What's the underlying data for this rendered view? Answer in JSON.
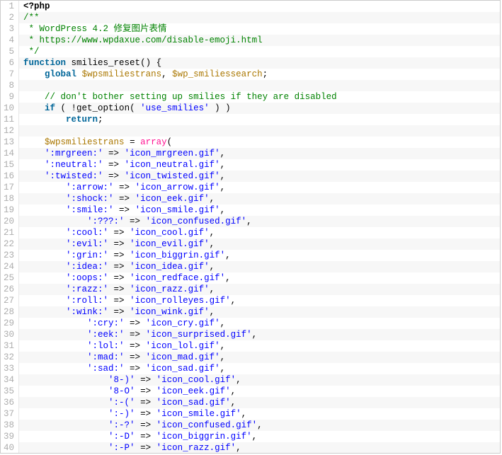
{
  "code": {
    "lines": [
      {
        "n": 1,
        "indent": 0,
        "tokens": [
          {
            "t": "<?php",
            "c": "tok-open"
          }
        ]
      },
      {
        "n": 2,
        "indent": 0,
        "tokens": [
          {
            "t": "/**",
            "c": "tok-comment"
          }
        ]
      },
      {
        "n": 3,
        "indent": 0,
        "tokens": [
          {
            "t": " * WordPress 4.2 修复图片表情",
            "c": "tok-comment"
          }
        ]
      },
      {
        "n": 4,
        "indent": 0,
        "tokens": [
          {
            "t": " * https://www.wpdaxue.com/disable-emoji.html",
            "c": "tok-comment"
          }
        ]
      },
      {
        "n": 5,
        "indent": 0,
        "tokens": [
          {
            "t": " */",
            "c": "tok-comment"
          }
        ]
      },
      {
        "n": 6,
        "indent": 0,
        "tokens": [
          {
            "t": "function",
            "c": "tok-keyword"
          },
          {
            "t": " ",
            "c": ""
          },
          {
            "t": "smilies_reset",
            "c": "tok-funcname"
          },
          {
            "t": "() {",
            "c": "tok-brace"
          }
        ]
      },
      {
        "n": 7,
        "indent": 1,
        "tokens": [
          {
            "t": "global",
            "c": "tok-keyword"
          },
          {
            "t": " ",
            "c": ""
          },
          {
            "t": "$wpsmiliestrans",
            "c": "tok-var"
          },
          {
            "t": ", ",
            "c": "tok-punct"
          },
          {
            "t": "$wp_smiliessearch",
            "c": "tok-var"
          },
          {
            "t": ";",
            "c": "tok-punct"
          }
        ]
      },
      {
        "n": 8,
        "indent": 0,
        "tokens": []
      },
      {
        "n": 9,
        "indent": 1,
        "tokens": [
          {
            "t": "// don't bother setting up smilies if they are disabled",
            "c": "tok-comment"
          }
        ]
      },
      {
        "n": 10,
        "indent": 1,
        "tokens": [
          {
            "t": "if",
            "c": "tok-keyword"
          },
          {
            "t": " ( !get_option( ",
            "c": "tok-punct"
          },
          {
            "t": "'use_smilies'",
            "c": "tok-string"
          },
          {
            "t": " ) )",
            "c": "tok-punct"
          }
        ]
      },
      {
        "n": 11,
        "indent": 2,
        "tokens": [
          {
            "t": "return",
            "c": "tok-keyword"
          },
          {
            "t": ";",
            "c": "tok-punct"
          }
        ]
      },
      {
        "n": 12,
        "indent": 0,
        "tokens": []
      },
      {
        "n": 13,
        "indent": 1,
        "tokens": [
          {
            "t": "$wpsmiliestrans",
            "c": "tok-var"
          },
          {
            "t": " = ",
            "c": "tok-eq"
          },
          {
            "t": "array",
            "c": "tok-func"
          },
          {
            "t": "(",
            "c": "tok-punct"
          }
        ]
      },
      {
        "n": 14,
        "indent": 1,
        "tokens": [
          {
            "t": "':mrgreen:'",
            "c": "tok-string"
          },
          {
            "t": " => ",
            "c": "tok-arrow"
          },
          {
            "t": "'icon_mrgreen.gif'",
            "c": "tok-string"
          },
          {
            "t": ",",
            "c": "tok-punct"
          }
        ]
      },
      {
        "n": 15,
        "indent": 1,
        "tokens": [
          {
            "t": "':neutral:'",
            "c": "tok-string"
          },
          {
            "t": " => ",
            "c": "tok-arrow"
          },
          {
            "t": "'icon_neutral.gif'",
            "c": "tok-string"
          },
          {
            "t": ",",
            "c": "tok-punct"
          }
        ]
      },
      {
        "n": 16,
        "indent": 1,
        "tokens": [
          {
            "t": "':twisted:'",
            "c": "tok-string"
          },
          {
            "t": " => ",
            "c": "tok-arrow"
          },
          {
            "t": "'icon_twisted.gif'",
            "c": "tok-string"
          },
          {
            "t": ",",
            "c": "tok-punct"
          }
        ]
      },
      {
        "n": 17,
        "indent": 2,
        "tokens": [
          {
            "t": "':arrow:'",
            "c": "tok-string"
          },
          {
            "t": " => ",
            "c": "tok-arrow"
          },
          {
            "t": "'icon_arrow.gif'",
            "c": "tok-string"
          },
          {
            "t": ",",
            "c": "tok-punct"
          }
        ]
      },
      {
        "n": 18,
        "indent": 2,
        "tokens": [
          {
            "t": "':shock:'",
            "c": "tok-string"
          },
          {
            "t": " => ",
            "c": "tok-arrow"
          },
          {
            "t": "'icon_eek.gif'",
            "c": "tok-string"
          },
          {
            "t": ",",
            "c": "tok-punct"
          }
        ]
      },
      {
        "n": 19,
        "indent": 2,
        "tokens": [
          {
            "t": "':smile:'",
            "c": "tok-string"
          },
          {
            "t": " => ",
            "c": "tok-arrow"
          },
          {
            "t": "'icon_smile.gif'",
            "c": "tok-string"
          },
          {
            "t": ",",
            "c": "tok-punct"
          }
        ]
      },
      {
        "n": 20,
        "indent": 3,
        "tokens": [
          {
            "t": "':???:'",
            "c": "tok-string"
          },
          {
            "t": " => ",
            "c": "tok-arrow"
          },
          {
            "t": "'icon_confused.gif'",
            "c": "tok-string"
          },
          {
            "t": ",",
            "c": "tok-punct"
          }
        ]
      },
      {
        "n": 21,
        "indent": 2,
        "tokens": [
          {
            "t": "':cool:'",
            "c": "tok-string"
          },
          {
            "t": " => ",
            "c": "tok-arrow"
          },
          {
            "t": "'icon_cool.gif'",
            "c": "tok-string"
          },
          {
            "t": ",",
            "c": "tok-punct"
          }
        ]
      },
      {
        "n": 22,
        "indent": 2,
        "tokens": [
          {
            "t": "':evil:'",
            "c": "tok-string"
          },
          {
            "t": " => ",
            "c": "tok-arrow"
          },
          {
            "t": "'icon_evil.gif'",
            "c": "tok-string"
          },
          {
            "t": ",",
            "c": "tok-punct"
          }
        ]
      },
      {
        "n": 23,
        "indent": 2,
        "tokens": [
          {
            "t": "':grin:'",
            "c": "tok-string"
          },
          {
            "t": " => ",
            "c": "tok-arrow"
          },
          {
            "t": "'icon_biggrin.gif'",
            "c": "tok-string"
          },
          {
            "t": ",",
            "c": "tok-punct"
          }
        ]
      },
      {
        "n": 24,
        "indent": 2,
        "tokens": [
          {
            "t": "':idea:'",
            "c": "tok-string"
          },
          {
            "t": " => ",
            "c": "tok-arrow"
          },
          {
            "t": "'icon_idea.gif'",
            "c": "tok-string"
          },
          {
            "t": ",",
            "c": "tok-punct"
          }
        ]
      },
      {
        "n": 25,
        "indent": 2,
        "tokens": [
          {
            "t": "':oops:'",
            "c": "tok-string"
          },
          {
            "t": " => ",
            "c": "tok-arrow"
          },
          {
            "t": "'icon_redface.gif'",
            "c": "tok-string"
          },
          {
            "t": ",",
            "c": "tok-punct"
          }
        ]
      },
      {
        "n": 26,
        "indent": 2,
        "tokens": [
          {
            "t": "':razz:'",
            "c": "tok-string"
          },
          {
            "t": " => ",
            "c": "tok-arrow"
          },
          {
            "t": "'icon_razz.gif'",
            "c": "tok-string"
          },
          {
            "t": ",",
            "c": "tok-punct"
          }
        ]
      },
      {
        "n": 27,
        "indent": 2,
        "tokens": [
          {
            "t": "':roll:'",
            "c": "tok-string"
          },
          {
            "t": " => ",
            "c": "tok-arrow"
          },
          {
            "t": "'icon_rolleyes.gif'",
            "c": "tok-string"
          },
          {
            "t": ",",
            "c": "tok-punct"
          }
        ]
      },
      {
        "n": 28,
        "indent": 2,
        "tokens": [
          {
            "t": "':wink:'",
            "c": "tok-string"
          },
          {
            "t": " => ",
            "c": "tok-arrow"
          },
          {
            "t": "'icon_wink.gif'",
            "c": "tok-string"
          },
          {
            "t": ",",
            "c": "tok-punct"
          }
        ]
      },
      {
        "n": 29,
        "indent": 3,
        "tokens": [
          {
            "t": "':cry:'",
            "c": "tok-string"
          },
          {
            "t": " => ",
            "c": "tok-arrow"
          },
          {
            "t": "'icon_cry.gif'",
            "c": "tok-string"
          },
          {
            "t": ",",
            "c": "tok-punct"
          }
        ]
      },
      {
        "n": 30,
        "indent": 3,
        "tokens": [
          {
            "t": "':eek:'",
            "c": "tok-string"
          },
          {
            "t": " => ",
            "c": "tok-arrow"
          },
          {
            "t": "'icon_surprised.gif'",
            "c": "tok-string"
          },
          {
            "t": ",",
            "c": "tok-punct"
          }
        ]
      },
      {
        "n": 31,
        "indent": 3,
        "tokens": [
          {
            "t": "':lol:'",
            "c": "tok-string"
          },
          {
            "t": " => ",
            "c": "tok-arrow"
          },
          {
            "t": "'icon_lol.gif'",
            "c": "tok-string"
          },
          {
            "t": ",",
            "c": "tok-punct"
          }
        ]
      },
      {
        "n": 32,
        "indent": 3,
        "tokens": [
          {
            "t": "':mad:'",
            "c": "tok-string"
          },
          {
            "t": " => ",
            "c": "tok-arrow"
          },
          {
            "t": "'icon_mad.gif'",
            "c": "tok-string"
          },
          {
            "t": ",",
            "c": "tok-punct"
          }
        ]
      },
      {
        "n": 33,
        "indent": 3,
        "tokens": [
          {
            "t": "':sad:'",
            "c": "tok-string"
          },
          {
            "t": " => ",
            "c": "tok-arrow"
          },
          {
            "t": "'icon_sad.gif'",
            "c": "tok-string"
          },
          {
            "t": ",",
            "c": "tok-punct"
          }
        ]
      },
      {
        "n": 34,
        "indent": 4,
        "tokens": [
          {
            "t": "'8-)'",
            "c": "tok-string"
          },
          {
            "t": " => ",
            "c": "tok-arrow"
          },
          {
            "t": "'icon_cool.gif'",
            "c": "tok-string"
          },
          {
            "t": ",",
            "c": "tok-punct"
          }
        ]
      },
      {
        "n": 35,
        "indent": 4,
        "tokens": [
          {
            "t": "'8-O'",
            "c": "tok-string"
          },
          {
            "t": " => ",
            "c": "tok-arrow"
          },
          {
            "t": "'icon_eek.gif'",
            "c": "tok-string"
          },
          {
            "t": ",",
            "c": "tok-punct"
          }
        ]
      },
      {
        "n": 36,
        "indent": 4,
        "tokens": [
          {
            "t": "':-('",
            "c": "tok-string"
          },
          {
            "t": " => ",
            "c": "tok-arrow"
          },
          {
            "t": "'icon_sad.gif'",
            "c": "tok-string"
          },
          {
            "t": ",",
            "c": "tok-punct"
          }
        ]
      },
      {
        "n": 37,
        "indent": 4,
        "tokens": [
          {
            "t": "':-)'",
            "c": "tok-string"
          },
          {
            "t": " => ",
            "c": "tok-arrow"
          },
          {
            "t": "'icon_smile.gif'",
            "c": "tok-string"
          },
          {
            "t": ",",
            "c": "tok-punct"
          }
        ]
      },
      {
        "n": 38,
        "indent": 4,
        "tokens": [
          {
            "t": "':-?'",
            "c": "tok-string"
          },
          {
            "t": " => ",
            "c": "tok-arrow"
          },
          {
            "t": "'icon_confused.gif'",
            "c": "tok-string"
          },
          {
            "t": ",",
            "c": "tok-punct"
          }
        ]
      },
      {
        "n": 39,
        "indent": 4,
        "tokens": [
          {
            "t": "':-D'",
            "c": "tok-string"
          },
          {
            "t": " => ",
            "c": "tok-arrow"
          },
          {
            "t": "'icon_biggrin.gif'",
            "c": "tok-string"
          },
          {
            "t": ",",
            "c": "tok-punct"
          }
        ]
      },
      {
        "n": 40,
        "indent": 4,
        "tokens": [
          {
            "t": "':-P'",
            "c": "tok-string"
          },
          {
            "t": " => ",
            "c": "tok-arrow"
          },
          {
            "t": "'icon_razz.gif'",
            "c": "tok-string"
          },
          {
            "t": ",",
            "c": "tok-punct"
          }
        ]
      }
    ]
  }
}
